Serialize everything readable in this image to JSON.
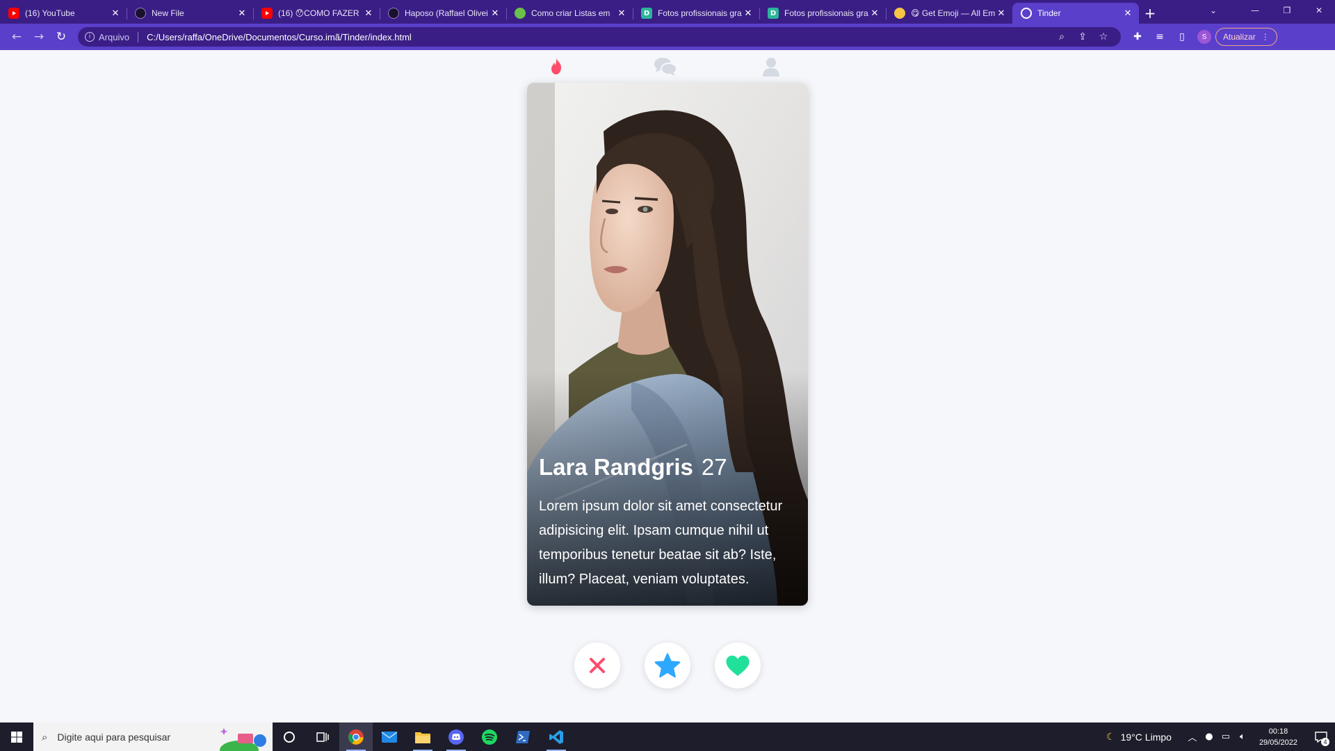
{
  "browser": {
    "tabs": [
      {
        "title": "(16) YouTube",
        "icon": "youtube-icon"
      },
      {
        "title": "New File",
        "icon": "github-icon"
      },
      {
        "title": "(16) 😯COMO FAZER",
        "icon": "youtube-icon"
      },
      {
        "title": "Haposo (Raffael Olivei",
        "icon": "github-icon"
      },
      {
        "title": "Como criar Listas em",
        "icon": "green-globe-icon"
      },
      {
        "title": "Fotos profissionais gra",
        "icon": "d-logo-icon"
      },
      {
        "title": "Fotos profissionais gra",
        "icon": "d-logo-icon"
      },
      {
        "title": "😋 Get Emoji — All Em",
        "icon": "emoji-icon"
      },
      {
        "title": "Tinder",
        "icon": "globe-icon",
        "active": true
      }
    ],
    "close_glyph": "✕",
    "new_tab_glyph": "+",
    "address": {
      "scheme_label": "Arquivo",
      "url": "C:/Users/raffa/OneDrive/Documentos/Curso.imã/Tinder/index.html"
    },
    "profile_initial": "S",
    "update_label": "Atualizar",
    "colors": {
      "tabbar": "#3a1e86",
      "toolbar": "#5a3fcb"
    }
  },
  "app": {
    "nav": [
      {
        "name": "flame-icon",
        "active": true
      },
      {
        "name": "chat-icon",
        "active": false
      },
      {
        "name": "user-icon",
        "active": false
      }
    ],
    "profile": {
      "name": "Lara Randgris",
      "age": "27",
      "bio": "Lorem ipsum dolor sit amet consectetur adipisicing elit. Ipsam cumque nihil ut temporibus tenetur beatae sit ab? Iste, illum? Placeat, veniam voluptates."
    },
    "actions": [
      {
        "name": "nope-button",
        "icon": "x-icon",
        "color": "#fe4c6a"
      },
      {
        "name": "super-like-button",
        "icon": "star-icon",
        "color": "#2ea8ff"
      },
      {
        "name": "like-button",
        "icon": "heart-icon",
        "color": "#21e09a"
      }
    ],
    "colors": {
      "brand": "#fe4c6a",
      "inactive_icon": "#d5d9e2",
      "background": "#f6f7fb"
    }
  },
  "taskbar": {
    "search_placeholder": "Digite aqui para pesquisar",
    "weather": "19°C  Limpo",
    "time": "00:18",
    "date": "29/05/2022",
    "notification_count": "4"
  }
}
